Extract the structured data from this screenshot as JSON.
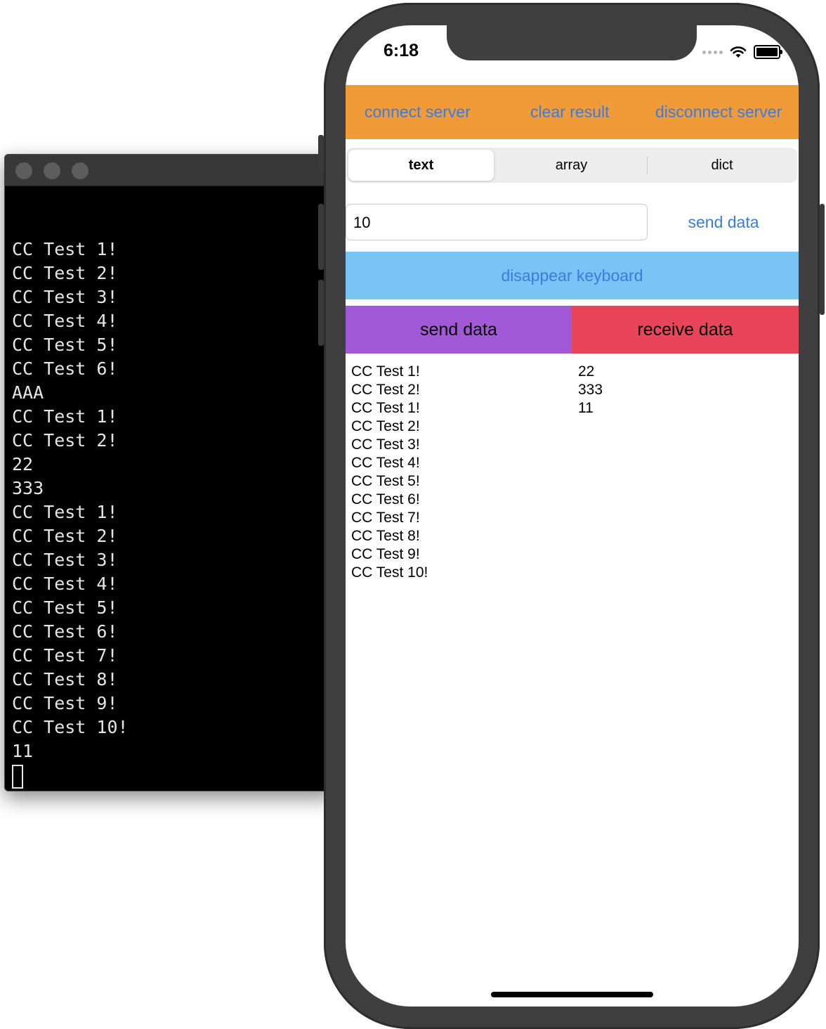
{
  "terminal": {
    "lines": [
      "CC Test 1!",
      "CC Test 2!",
      "CC Test 3!",
      "CC Test 4!",
      "CC Test 5!",
      "CC Test 6!",
      "AAA",
      "CC Test 1!",
      "CC Test 2!",
      "22",
      "333",
      "CC Test 1!",
      "CC Test 2!",
      "CC Test 3!",
      "CC Test 4!",
      "CC Test 5!",
      "CC Test 6!",
      "CC Test 7!",
      "CC Test 8!",
      "CC Test 9!",
      "CC Test 10!",
      "11"
    ]
  },
  "phone": {
    "status_time": "6:18",
    "top_bar": {
      "connect": "connect server",
      "clear": "clear result",
      "disconnect": "disconnect server"
    },
    "segments": [
      {
        "label": "text",
        "selected": true
      },
      {
        "label": "array",
        "selected": false
      },
      {
        "label": "dict",
        "selected": false
      }
    ],
    "input_value": "10",
    "send_link": "send data",
    "keyboard_button": "disappear keyboard",
    "send_header": "send data",
    "receive_header": "receive data",
    "sent": [
      "CC Test 1!",
      "CC Test 2!",
      "CC Test 1!",
      "CC Test 2!",
      "CC Test 3!",
      "CC Test 4!",
      "CC Test 5!",
      "CC Test 6!",
      "CC Test 7!",
      "CC Test 8!",
      "CC Test 9!",
      "CC Test 10!"
    ],
    "received": [
      "22",
      "333",
      "11"
    ]
  },
  "colors": {
    "top_bar": "#f09a38",
    "link_blue": "#3a7ce0",
    "keyboard_bar": "#78c4f5",
    "send_header": "#a259d7",
    "receive_header": "#e8455a"
  }
}
